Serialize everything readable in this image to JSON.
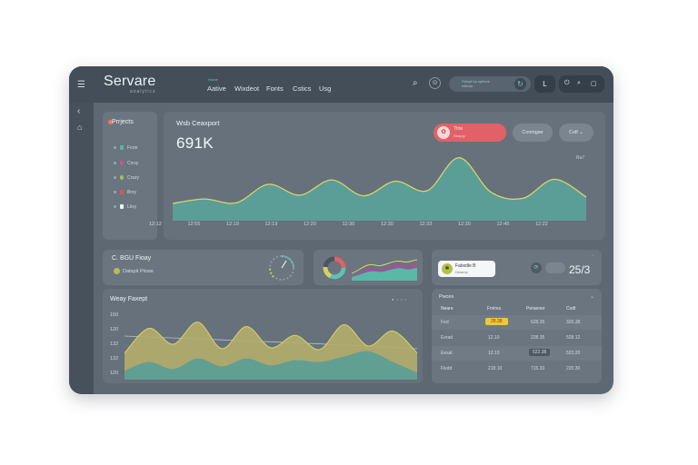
{
  "app": {
    "brand": "Servare",
    "brand_sub": "analytics"
  },
  "nav": {
    "active_tag": "Home",
    "items": [
      "Aative",
      "Wixdeot",
      "Fonts",
      "Cstics",
      "Usg"
    ]
  },
  "header": {
    "search_text": "Sslopt hp uptions",
    "search_sub": "ixthosk",
    "btn_l": "L",
    "ctrl_icons": [
      "⏻",
      "⌕",
      "▢"
    ]
  },
  "projects": {
    "title": "Prrjects",
    "items": [
      "Fooe",
      "Crroy",
      "Crazy",
      "Brxy",
      "Lkxy"
    ]
  },
  "web": {
    "title": "Wsb Ceaxport",
    "value": "691K",
    "red_button": {
      "line1": "Tfrte",
      "line2": "Searpy"
    },
    "buttons": [
      "Covmgse",
      "Colf"
    ],
    "ytick": "Ra7",
    "xticks": [
      "12:12",
      "12:55",
      "12:19",
      "12:19",
      "12:20",
      "12:30",
      "12:30",
      "12:33",
      "12:30",
      "12:45",
      "12:22"
    ]
  },
  "mini1": {
    "title": "C. BGU Fioay",
    "sub": "Datapit Plowe"
  },
  "chart_data": [
    {
      "type": "area",
      "title": "Wsb Ceaxport",
      "x": [
        "12:12",
        "12:55",
        "12:19",
        "12:19",
        "12:20",
        "12:30",
        "12:30",
        "12:33",
        "12:30",
        "12:45",
        "12:22"
      ],
      "series": [
        {
          "values": [
            20,
            27,
            21,
            50,
            33,
            57,
            32,
            55,
            40,
            92,
            38,
            28,
            58,
            30
          ]
        }
      ]
    },
    {
      "type": "area",
      "title": "Weay Faxept",
      "ylabels": [
        "150",
        "120",
        "132",
        "132",
        "120"
      ],
      "series": [
        {
          "values": [
            30,
            58,
            40,
            65,
            35,
            60,
            36,
            50,
            34,
            62,
            38,
            55,
            30
          ]
        },
        {
          "values": [
            10,
            20,
            12,
            24,
            15,
            24,
            16,
            22,
            20,
            26,
            32,
            20,
            8
          ]
        }
      ]
    }
  ],
  "weekly": {
    "title": "Weay Faxept",
    "ylabels": [
      "150",
      "120",
      "132",
      "132",
      "120"
    ],
    "legend": "● • • •"
  },
  "stats": {
    "pill_l1": "Fabxdle B",
    "pill_l2": "Deseoy",
    "value": "25/3"
  },
  "table": {
    "title": "Pwces",
    "headers": [
      "Neare",
      "Fmlres",
      "Peraener",
      "Codt"
    ],
    "rows": [
      [
        "Fed",
        "28.38",
        "628.35",
        "320.38"
      ],
      [
        "Exrad",
        "12.10",
        "228.35",
        "528.12"
      ],
      [
        "Eesal",
        "12.10",
        "522.38",
        "523.20"
      ],
      [
        "Flxdd",
        "218.10",
        "715.33",
        "220.30"
      ]
    ]
  },
  "colors": {
    "accent": "#5a9e97",
    "line": "#d9d36a",
    "red": "#e06268",
    "yellow": "#f2c443"
  }
}
